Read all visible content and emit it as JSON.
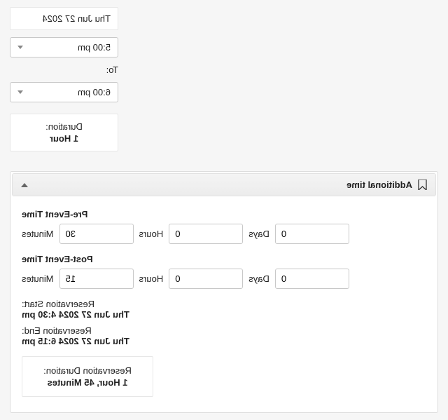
{
  "top": {
    "date": "Thu Jun 27 2024",
    "from_time": "5:00 pm",
    "to_label": "To:",
    "to_time": "6:00 pm",
    "duration_label": "Duration:",
    "duration_value": "1 Hour"
  },
  "additional": {
    "panel_title": "Additional time",
    "pre_label": "Pre-Event Time",
    "post_label": "Post-Event Time",
    "units": {
      "days": "Days",
      "hours": "Hours",
      "minutes": "Minutes"
    },
    "pre": {
      "days": "0",
      "hours": "0",
      "minutes": "30"
    },
    "post": {
      "days": "0",
      "hours": "0",
      "minutes": "15"
    },
    "res_start_label": "Reservation Start:",
    "res_start_value": "Thu Jun 27 2024 4:30 pm",
    "res_end_label": "Reservation End:",
    "res_end_value": "Thu Jun 27 2024 6:15 pm",
    "res_dur_label": "Reservation Duration:",
    "res_dur_value": "1 Hour, 45 Minutes"
  }
}
